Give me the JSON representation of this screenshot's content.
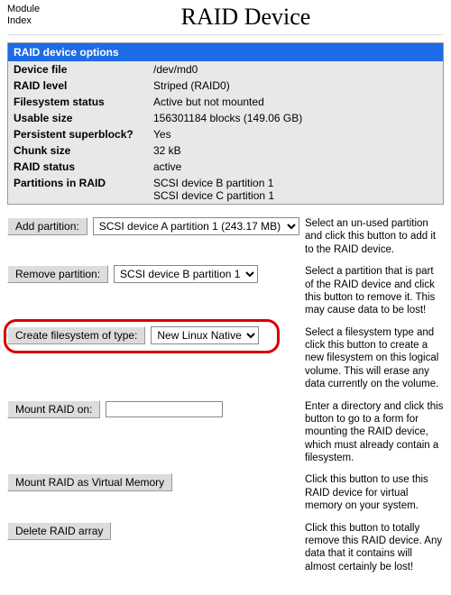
{
  "header": {
    "module_index": "Module\nIndex",
    "title": "RAID Device"
  },
  "panel": {
    "heading": "RAID device options",
    "rows": [
      {
        "label": "Device file",
        "value": "/dev/md0"
      },
      {
        "label": "RAID level",
        "value": "Striped (RAID0)"
      },
      {
        "label": "Filesystem status",
        "value": "Active but not mounted"
      },
      {
        "label": "Usable size",
        "value": "156301184 blocks (149.06 GB)"
      },
      {
        "label": "Persistent superblock?",
        "value": "Yes"
      },
      {
        "label": "Chunk size",
        "value": "32 kB"
      },
      {
        "label": "RAID status",
        "value": "active"
      },
      {
        "label": "Partitions in RAID",
        "value": "SCSI device B partition 1",
        "value2": "SCSI device C partition 1"
      }
    ]
  },
  "actions": {
    "add_partition": {
      "button": "Add partition:",
      "selected": "SCSI device A partition 1 (243.17 MB)",
      "desc": "Select an un-used partition and click this button to add it to the RAID device."
    },
    "remove_partition": {
      "button": "Remove partition:",
      "selected": "SCSI device B partition 1",
      "desc": "Select a partition that is part of the RAID device and click this button to remove it. This may cause data to be lost!"
    },
    "create_fs": {
      "button": "Create filesystem of type:",
      "selected": "New Linux Native",
      "desc": "Select a filesystem type and click this button to create a new filesystem on this logical volume. This will erase any data currently on the volume."
    },
    "mount_on": {
      "button": "Mount RAID on:",
      "value": "",
      "desc": "Enter a directory and click this button to go to a form for mounting the RAID device, which must already contain a filesystem."
    },
    "mount_vm": {
      "button": "Mount RAID as Virtual Memory",
      "desc": "Click this button to use this RAID device for virtual memory on your system."
    },
    "delete": {
      "button": "Delete RAID array",
      "desc": "Click this button to totally remove this RAID device. Any data that it contains will almost certainly be lost!"
    }
  }
}
